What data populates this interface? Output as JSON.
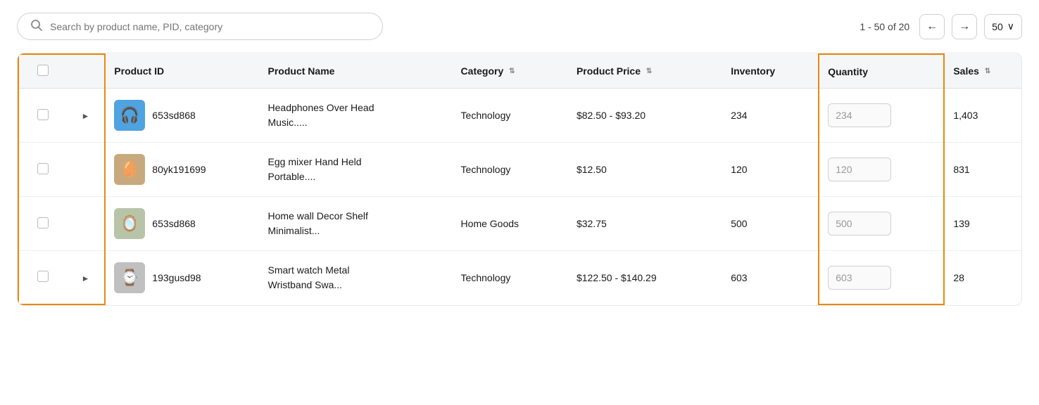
{
  "search": {
    "placeholder": "Search by product name, PID, category",
    "value": ""
  },
  "pagination": {
    "info": "1 - 50 of 20",
    "per_page": "50",
    "prev_label": "←",
    "next_label": "→",
    "chevron": "∨"
  },
  "table": {
    "columns": [
      {
        "key": "checkbox",
        "label": ""
      },
      {
        "key": "expand",
        "label": ""
      },
      {
        "key": "product_id",
        "label": "Product ID"
      },
      {
        "key": "product_name",
        "label": "Product Name"
      },
      {
        "key": "category",
        "label": "Category",
        "sortable": true
      },
      {
        "key": "product_price",
        "label": "Product Price",
        "sortable": true
      },
      {
        "key": "inventory",
        "label": "Inventory"
      },
      {
        "key": "quantity",
        "label": "Quantity"
      },
      {
        "key": "sales",
        "label": "Sales",
        "sortable": true
      }
    ],
    "rows": [
      {
        "id": "row-1",
        "product_id": "653sd868",
        "product_name": "Headphones Over Head\nMusic.....",
        "category": "Technology",
        "product_price": "$82.50 - $93.20",
        "inventory": "234",
        "quantity": "234",
        "sales": "1,403",
        "has_expand": true,
        "img_type": "headphones",
        "img_emoji": "🎧"
      },
      {
        "id": "row-2",
        "product_id": "80yk191699",
        "product_name": "Egg mixer Hand Held\nPortable....",
        "category": "Technology",
        "product_price": "$12.50",
        "inventory": "120",
        "quantity": "120",
        "sales": "831",
        "has_expand": false,
        "img_type": "egg",
        "img_emoji": "🥚"
      },
      {
        "id": "row-3",
        "product_id": "653sd868",
        "product_name": "Home wall Decor Shelf\nMinimalist...",
        "category": "Home Goods",
        "product_price": "$32.75",
        "inventory": "500",
        "quantity": "500",
        "sales": "139",
        "has_expand": false,
        "img_type": "shelf",
        "img_emoji": "🪞"
      },
      {
        "id": "row-4",
        "product_id": "193gusd98",
        "product_name": "Smart watch Metal\nWristband Swa...",
        "category": "Technology",
        "product_price": "$122.50 - $140.29",
        "inventory": "603",
        "quantity": "603",
        "sales": "28",
        "has_expand": true,
        "img_type": "watch",
        "img_emoji": "⌚"
      }
    ]
  }
}
